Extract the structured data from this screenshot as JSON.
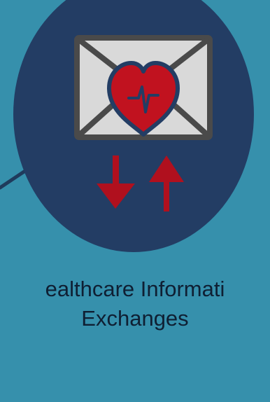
{
  "caption": {
    "line1": "ealthcare Informati",
    "line2": "Exchanges"
  },
  "icon": {
    "name": "health-information-exchange-icon",
    "parts": [
      "envelope-icon",
      "heart-icon",
      "heartbeat-icon",
      "arrow-down-icon",
      "arrow-up-icon"
    ]
  },
  "colors": {
    "background": "#3690ac",
    "circle": "#233d64",
    "envelope_fill": "#d9d9d9",
    "envelope_stroke": "#4a4a4a",
    "heart": "#c1121f",
    "arrows": "#b0101e",
    "caption_text": "#0f1f33"
  }
}
